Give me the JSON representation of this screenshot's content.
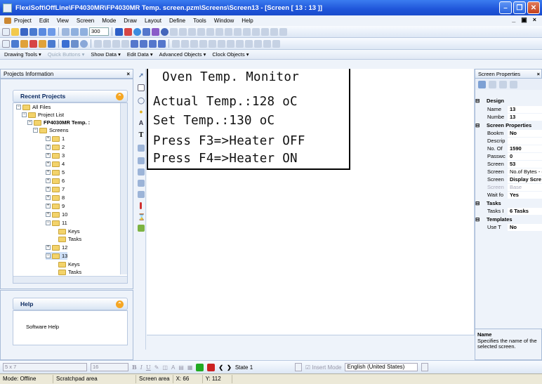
{
  "window": {
    "title": "FlexiSoft\\OffLine\\FP4030MR\\FP4030MR Temp. screen.pzm\\Screens\\Screen13 - [Screen [ 13 : 13 ]]"
  },
  "menu": [
    "Project",
    "Edit",
    "View",
    "Screen",
    "Mode",
    "Draw",
    "Layout",
    "Define",
    "Tools",
    "Window",
    "Help"
  ],
  "mdi_controls": [
    "_",
    "æ",
    "×"
  ],
  "toolbar": {
    "zoom": "300"
  },
  "toolbar_row3": {
    "drawing_tools": "Drawing Tools ▾",
    "quick_buttons": "Quick Buttons ▾",
    "show_data": "Show Data ▾",
    "edit_data": "Edit Data ▾",
    "advanced_objects": "Advanced Objects ▾",
    "clock_objects": "Clock Objects ▾"
  },
  "projects_panel": {
    "title": "Projects Information",
    "recent_projects": "Recent Projects",
    "tree": {
      "all_files": "All Files",
      "project_list": "Project List",
      "project": "FP4030MR Temp. :",
      "screens": "Screens",
      "items": [
        "1",
        "2",
        "3",
        "4",
        "5",
        "6",
        "7",
        "8",
        "9",
        "10",
        "11",
        "Keys",
        "Tasks",
        "12",
        "13",
        "Keys",
        "Tasks"
      ]
    }
  },
  "help_panel": {
    "title": "Help",
    "text": "Software Help"
  },
  "lcd": {
    "line1": "Oven Temp. Monitor",
    "line2": "Actual Temp.:128 oC",
    "line3": "Set Temp.:130 oC",
    "line4": "Press F3=>Heater OFF",
    "line5": "Press F4=>Heater ON"
  },
  "properties": {
    "title": "Screen Properties",
    "rows": [
      {
        "cat": "Design"
      },
      {
        "name": "Name",
        "value": "13"
      },
      {
        "name": "Numbe",
        "value": "13"
      },
      {
        "cat": "Screen Properties"
      },
      {
        "name": "Bookm",
        "value": "No"
      },
      {
        "name": "Descrip",
        "value": ""
      },
      {
        "name": "No. Of",
        "value": "1590"
      },
      {
        "name": "Passwc",
        "value": "0"
      },
      {
        "name": "Screen",
        "value": "53"
      },
      {
        "name": "Screen",
        "value": "No.of Bytes - ("
      },
      {
        "name": "Screen",
        "value": "Display Scre"
      },
      {
        "name": "Screen",
        "value": "Base"
      },
      {
        "name": "Wait fo",
        "value": "Yes"
      },
      {
        "cat": "Tasks"
      },
      {
        "name": "Tasks I",
        "value": "6 Tasks"
      },
      {
        "cat": "Templates"
      },
      {
        "name": "Use T",
        "value": "No"
      }
    ],
    "desc_title": "Name",
    "desc_text": "Specifies the name of the selected screen."
  },
  "format_bar": {
    "font": "5 x 7",
    "size": "16",
    "state": "State 1",
    "insert_mode": "Insert Mode",
    "language": "English (United States)"
  },
  "status_bar": {
    "mode": "Mode: Offline",
    "scratchpad": "Scratchpad area",
    "screen_area": "Screen area",
    "x": "X: 66",
    "y": "Y: 112"
  },
  "colors": {
    "titlebar": "#1f55d9",
    "panel_bg": "#eef3fa",
    "accent_orange": "#f5a623"
  }
}
